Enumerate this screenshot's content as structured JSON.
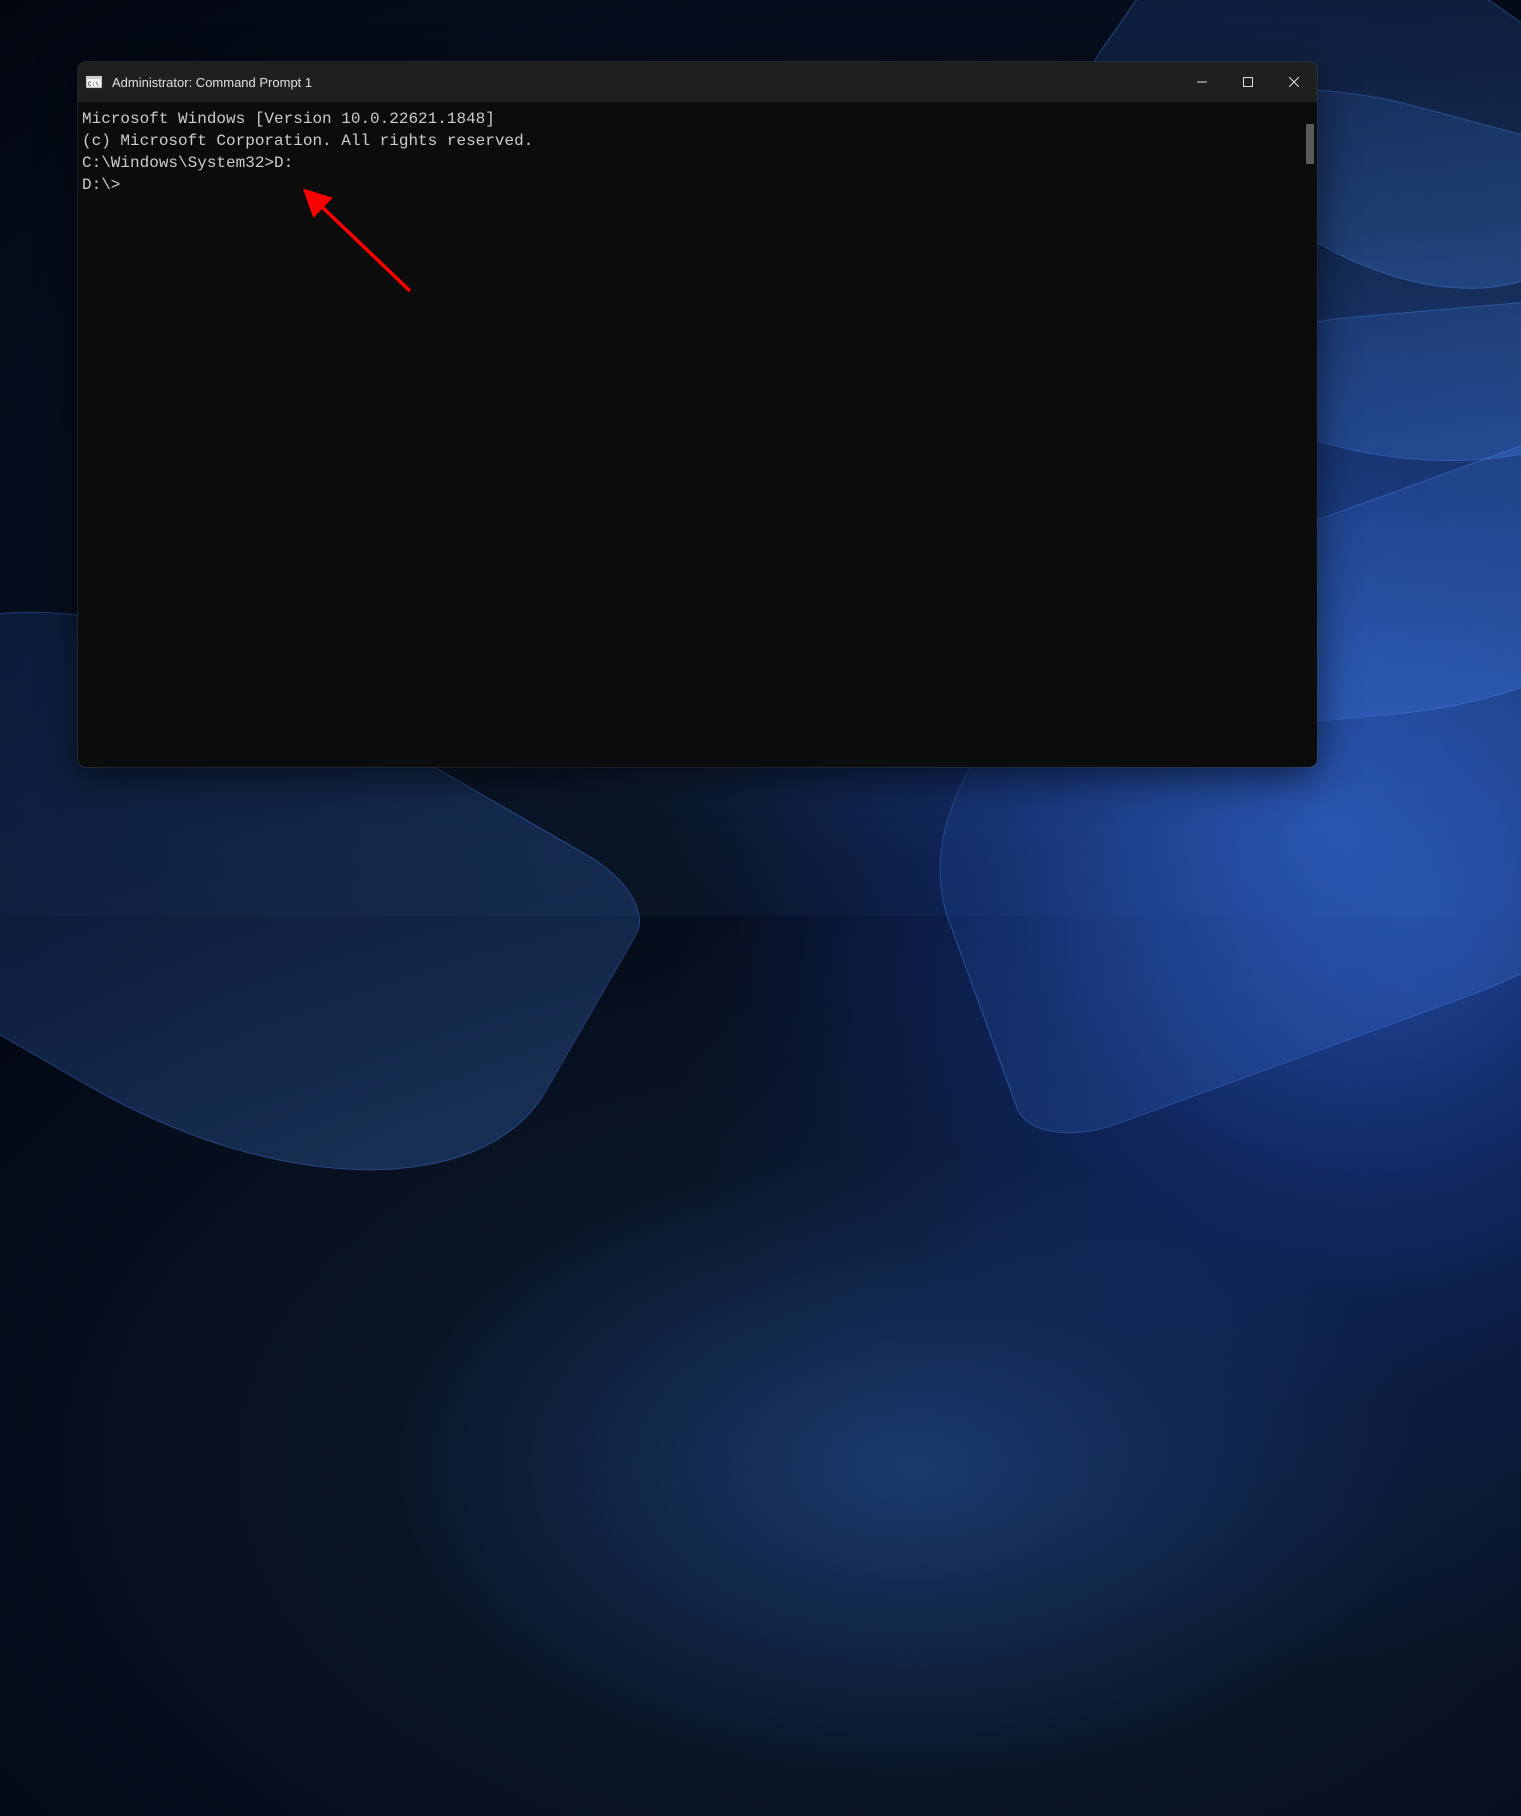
{
  "window": {
    "title": "Administrator: Command Prompt 1"
  },
  "terminal": {
    "lines": [
      "Microsoft Windows [Version 10.0.22621.1848]",
      "(c) Microsoft Corporation. All rights reserved.",
      "",
      "C:\\Windows\\System32>D:",
      "",
      "D:\\>"
    ]
  },
  "annotation": {
    "type": "arrow",
    "color": "#ff0000"
  }
}
